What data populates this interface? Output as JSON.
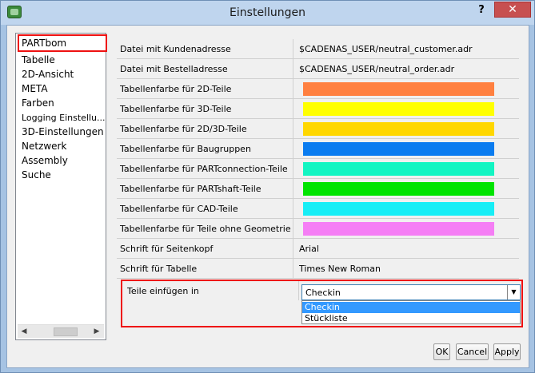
{
  "window": {
    "title": "Einstellungen",
    "help": "?",
    "close": "✕"
  },
  "sidebar": {
    "items": [
      {
        "label": "PARTbom",
        "selected": true
      },
      {
        "label": "Tabelle"
      },
      {
        "label": "2D-Ansicht"
      },
      {
        "label": "META"
      },
      {
        "label": "Farben"
      },
      {
        "label": "Logging Einstellu..."
      },
      {
        "label": "3D-Einstellungen"
      },
      {
        "label": "Netzwerk"
      },
      {
        "label": "Assembly"
      },
      {
        "label": "Suche"
      }
    ],
    "scroll_left": "◀",
    "scroll_right": "▶"
  },
  "settings": [
    {
      "label": "Datei mit Kundenadresse",
      "value": "$CADENAS_USER/neutral_customer.adr"
    },
    {
      "label": "Datei mit Bestelladresse",
      "value": "$CADENAS_USER/neutral_order.adr"
    },
    {
      "label": "Tabellenfarbe für 2D-Teile",
      "color": "#ff8040"
    },
    {
      "label": "Tabellenfarbe für 3D-Teile",
      "color": "#ffff00"
    },
    {
      "label": "Tabellenfarbe für 2D/3D-Teile",
      "color": "#ffd700"
    },
    {
      "label": "Tabellenfarbe für Baugruppen",
      "color": "#0a7cf0"
    },
    {
      "label": "Tabellenfarbe für PARTconnection-Teile",
      "color": "#12f5c2"
    },
    {
      "label": "Tabellenfarbe für PARTshaft-Teile",
      "color": "#00e400"
    },
    {
      "label": "Tabellenfarbe für CAD-Teile",
      "color": "#17eef6"
    },
    {
      "label": "Tabellenfarbe für Teile ohne Geometrie",
      "color": "#f57ef5"
    },
    {
      "label": "Schrift für Seitenkopf",
      "value": "Arial"
    },
    {
      "label": "Schrift für Tabelle",
      "value": "Times New Roman"
    }
  ],
  "insert_parts": {
    "label": "Teile einfügen in",
    "selected": "Checkin",
    "arrow": "▼",
    "options": [
      "Checkin",
      "Stückliste"
    ]
  },
  "buttons": {
    "ok": "OK",
    "cancel": "Cancel",
    "apply": "Apply"
  },
  "colors": {
    "highlight": "#ee1111",
    "selection": "#3399ff"
  }
}
